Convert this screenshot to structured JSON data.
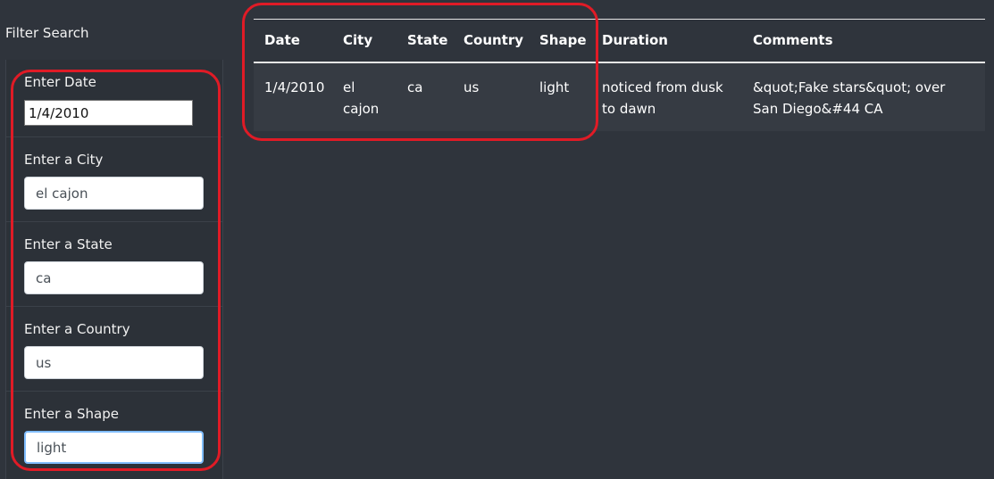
{
  "sidebar": {
    "title": "Filter Search",
    "filters": [
      {
        "label": "Enter Date",
        "value": "1/4/2010",
        "placeholder": ""
      },
      {
        "label": "Enter a City",
        "value": "el cajon",
        "placeholder": ""
      },
      {
        "label": "Enter a State",
        "value": "ca",
        "placeholder": ""
      },
      {
        "label": "Enter a Country",
        "value": "us",
        "placeholder": ""
      },
      {
        "label": "Enter a Shape",
        "value": "light",
        "placeholder": ""
      }
    ]
  },
  "table": {
    "headers": [
      "Date",
      "City",
      "State",
      "Country",
      "Shape",
      "Duration",
      "Comments"
    ],
    "rows": [
      [
        "1/4/2010",
        "el cajon",
        "ca",
        "us",
        "light",
        "noticed from dusk to dawn",
        "&quot;Fake stars&quot; over San Diego&#44 CA"
      ]
    ]
  },
  "colors": {
    "background": "#2f343c",
    "annotation": "#e01b26",
    "focus_ring": "#80bdff"
  }
}
